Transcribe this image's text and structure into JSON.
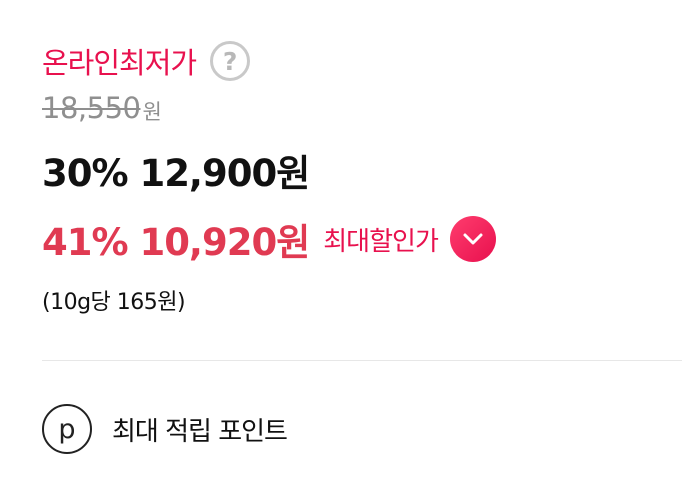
{
  "online": {
    "label": "온라인최저가",
    "help_icon_glyph": "?"
  },
  "original": {
    "price": "18,550",
    "unit": "원"
  },
  "sale": {
    "text": "30% 12,900원"
  },
  "max_discount": {
    "text": "41% 10,920원",
    "label": "최대할인가"
  },
  "unit_price": {
    "text": "(10g당 165원)"
  },
  "points": {
    "icon_glyph": "p",
    "label": "최대 적립 포인트"
  },
  "colors": {
    "accent": "#e8114e",
    "max_price": "#e03a52",
    "strikethrough": "#8f8f8f",
    "divider": "#e7e7e7"
  },
  "icons": [
    "question-icon",
    "chevron-down-icon",
    "point-icon"
  ]
}
